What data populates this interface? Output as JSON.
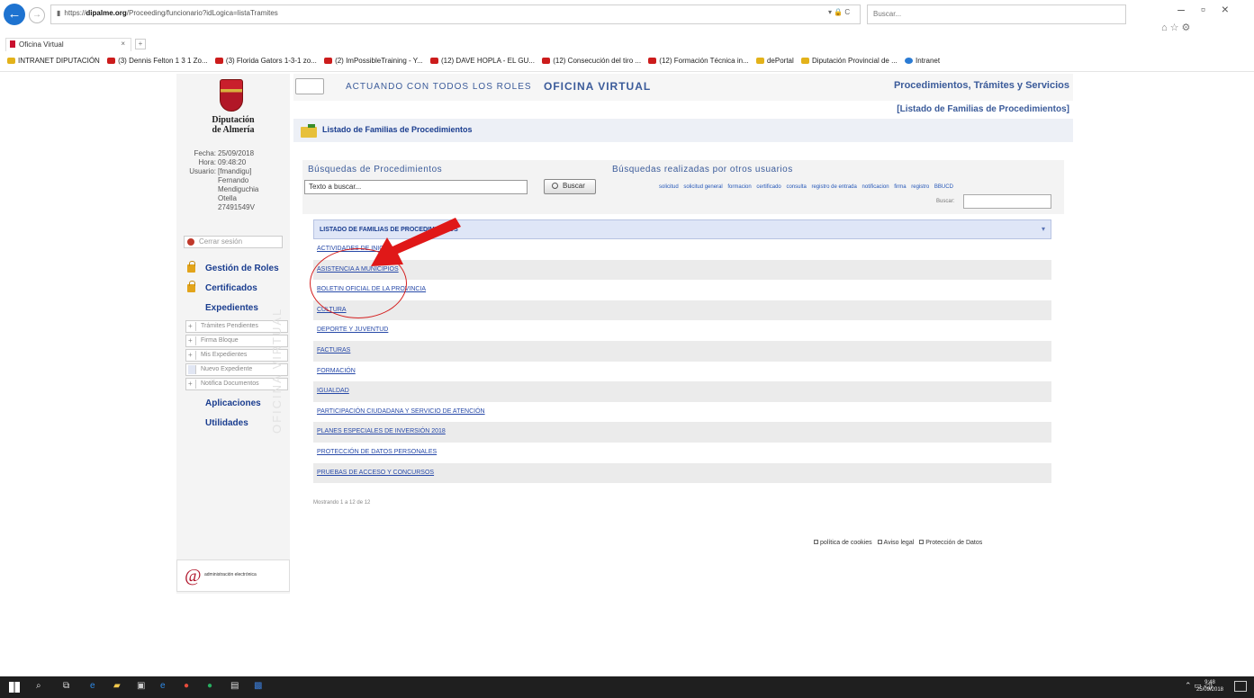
{
  "browser": {
    "url_prefix": "https://",
    "url_domain": "dipalme.org",
    "url_path": "/Proceeding/funcionario?idLogica=listaTramites",
    "addr_tools": "▾ 🔒 C",
    "search_placeholder": "Buscar...",
    "tab_title": "Oficina Virtual",
    "tab_close": "×",
    "favorites": [
      "INTRANET DIPUTACIÓN",
      "(3) Dennis Felton 1 3 1 Zo...",
      "(3) Florida Gators 1-3-1 zo...",
      "(2) ImPossibleTraining - Y...",
      "(12) DAVE HOPLA - EL GU...",
      "(12) Consecución del tiro ...",
      "(12) Formación Técnica in...",
      "dePortal",
      "Diputación Provincial de ...",
      "Intranet"
    ]
  },
  "sidebar": {
    "institution_line1": "Diputación",
    "institution_line2": "de Almería",
    "date_label": "Fecha:",
    "date_value": "25/09/2018",
    "time_label": "Hora:",
    "time_value": "09:48:20",
    "user_label": "Usuario:",
    "user_lines": [
      "[fmandigu]",
      "Fernando",
      "Mendiguchia",
      "Otella",
      "27491549V"
    ],
    "logout_label": "Cerrar sesión",
    "menu": {
      "roles": "Gestión de Roles",
      "certificados": "Certificados",
      "expedientes": "Expedientes",
      "sub_items": [
        "Trámites Pendientes",
        "Firma Bloque",
        "Mis Expedientes",
        "Nuevo Expediente",
        "Notifica Documentos"
      ],
      "aplicaciones": "Aplicaciones",
      "utilidades": "Utilidades"
    },
    "watermark": "OFICINA VIRTUAL",
    "ae_logo_text": "administración electrónica"
  },
  "header": {
    "roles_text": "ACTUANDO CON TODOS LOS ROLES",
    "office_text": "OFICINA VIRTUAL",
    "proc_title": "Procedimientos, Trámites y Servicios",
    "breadcrumb": "[Listado de Familias de Procedimientos]",
    "list_title": "Listado de Familias de Procedimientos"
  },
  "search": {
    "title": "Búsquedas de Procedimientos",
    "others_title": "Búsquedas realizadas por otros usuarios",
    "input_value": "Texto a buscar...",
    "button_label": "Buscar",
    "tags": [
      "solicitud",
      "solicitud general",
      "formacion",
      "certificado",
      "consulta",
      "registro de entrada",
      "notificacion",
      "firma",
      "registro",
      "BBUCD"
    ],
    "buscar_label": "Buscar:"
  },
  "families": {
    "header": "LISTADO DE FAMILIAS DE PROCEDIMIENTOS",
    "header_caret": "▾",
    "rows": [
      "ACTIVIDADES DE INICIO",
      "ASISTENCIA A MUNICIPIOS",
      "BOLETIN OFICIAL DE LA PROVINCIA",
      "CULTURA",
      "DEPORTE Y JUVENTUD",
      "FACTURAS",
      "FORMACIÓN",
      "IGUALDAD",
      "PARTICIPACIÓN CIUDADANA Y SERVICIO DE ATENCIÓN",
      "PLANES ESPECIALES DE INVERSIÓN 2018",
      "PROTECCIÓN DE DATOS PERSONALES",
      "PRUEBAS DE ACCESO Y CONCURSOS"
    ],
    "showing": "Mostrando 1 a 12 de 12"
  },
  "footer": {
    "cookies": "política de cookies",
    "legal": "Aviso legal",
    "data": "Protección de Datos"
  },
  "taskbar": {
    "time": "9:48",
    "date": "25/09/2018",
    "tray": "⌃ ▭ ◁)"
  },
  "colors": {
    "link": "#2749a8",
    "header_blue": "#3b5b9a",
    "annotation_red": "#d42020"
  }
}
